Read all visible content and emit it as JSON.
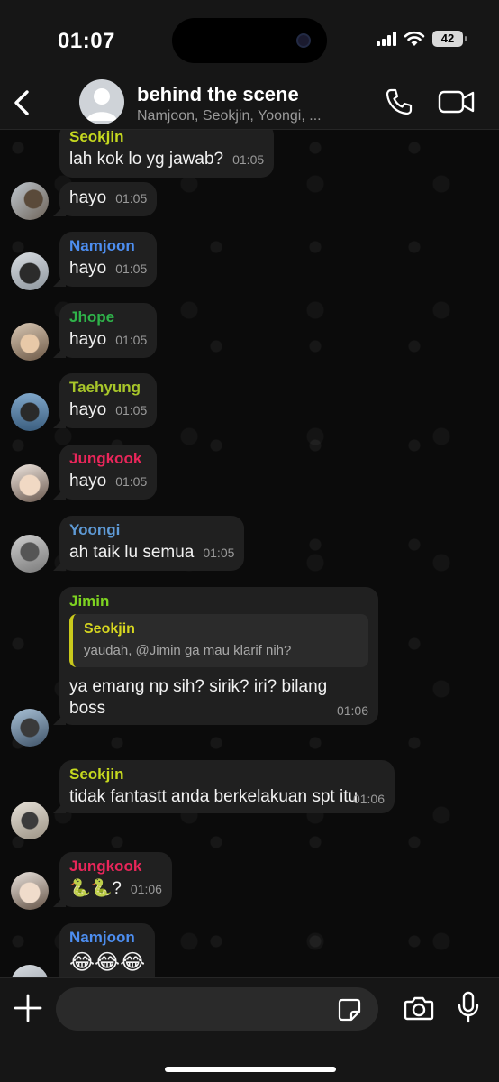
{
  "status_bar": {
    "time": "01:07",
    "battery": "42"
  },
  "header": {
    "title": "behind the scene",
    "subtitle": "Namjoon, Seokjin, Yoongi, ..."
  },
  "messages": [
    {
      "sender": "Seokjin",
      "sender_color": "#c6d91f",
      "text": "lah kok lo yg jawab?",
      "time": "01:05"
    },
    {
      "sender": "",
      "text": "hayo",
      "time": "01:05"
    },
    {
      "sender": "Namjoon",
      "sender_color": "#4d8ef0",
      "text": "hayo",
      "time": "01:05"
    },
    {
      "sender": "Jhope",
      "sender_color": "#2fb34a",
      "text": "hayo",
      "time": "01:05"
    },
    {
      "sender": "Taehyung",
      "sender_color": "#a7c52a",
      "text": "hayo",
      "time": "01:05"
    },
    {
      "sender": "Jungkook",
      "sender_color": "#e9265a",
      "text": "hayo",
      "time": "01:05"
    },
    {
      "sender": "Yoongi",
      "sender_color": "#5e9ad6",
      "text": "ah taik lu semua",
      "time": "01:05"
    },
    {
      "sender": "Jimin",
      "sender_color": "#7ed321",
      "quote": {
        "sender": "Seokjin",
        "text": "yaudah, @Jimin ga mau klarif nih?"
      },
      "text": "ya emang np sih? sirik? iri? bilang boss",
      "time": "01:06"
    },
    {
      "sender": "Seokjin",
      "sender_color": "#c6d91f",
      "text": "tidak fantastt anda berkelakuan spt itu",
      "time": "01:06"
    },
    {
      "sender": "Jungkook",
      "sender_color": "#e9265a",
      "text": "🐍🐍?",
      "time": "01:06"
    },
    {
      "sender": "Namjoon",
      "sender_color": "#4d8ef0",
      "text": "😂😂😂",
      "time": ""
    }
  ],
  "composer": {
    "placeholder": ""
  },
  "icons": {
    "back": "chevron-left-icon",
    "call": "phone-icon",
    "video": "video-camera-icon",
    "plus": "plus-icon",
    "sticker": "sticker-icon",
    "camera": "camera-icon",
    "mic": "microphone-icon"
  }
}
